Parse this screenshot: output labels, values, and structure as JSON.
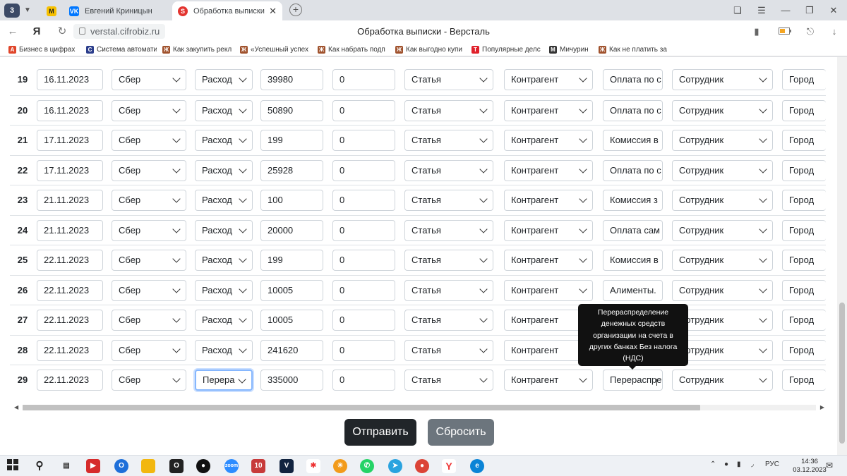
{
  "browser": {
    "tab_count": "3",
    "tabs": [
      {
        "label": "",
        "icon": "mail-icon",
        "active": false
      },
      {
        "label": "Евгений Криницын",
        "icon": "vk-icon",
        "active": false
      },
      {
        "label": "Обработка выписки - В",
        "icon": "cifrobiz-icon",
        "active": true
      }
    ],
    "url": "verstal.cifrobiz.ru",
    "page_title": "Обработка выписки - Версталь",
    "bookmarks": [
      "Бизнес в цифрах",
      "Система автомати",
      "Как закупить рекл",
      "«Успешный успех",
      "Как набрать подп",
      "Как выгодно купи",
      "Популярные делс",
      "Мичурин",
      "Как не платить за"
    ]
  },
  "table": {
    "rows": [
      {
        "num": "19",
        "date": "16.11.2023",
        "bank": "Сбер",
        "type": "Расход",
        "amount": "39980",
        "extra": "0",
        "article": "Статья",
        "counterparty": "Контрагент",
        "purpose": "Оплата по с",
        "employee": "Сотрудник",
        "city": "Город"
      },
      {
        "num": "20",
        "date": "16.11.2023",
        "bank": "Сбер",
        "type": "Расход",
        "amount": "50890",
        "extra": "0",
        "article": "Статья",
        "counterparty": "Контрагент",
        "purpose": "Оплата по с",
        "employee": "Сотрудник",
        "city": "Город"
      },
      {
        "num": "21",
        "date": "17.11.2023",
        "bank": "Сбер",
        "type": "Расход",
        "amount": "199",
        "extra": "0",
        "article": "Статья",
        "counterparty": "Контрагент",
        "purpose": "Комиссия в",
        "employee": "Сотрудник",
        "city": "Город"
      },
      {
        "num": "22",
        "date": "17.11.2023",
        "bank": "Сбер",
        "type": "Расход",
        "amount": "25928",
        "extra": "0",
        "article": "Статья",
        "counterparty": "Контрагент",
        "purpose": "Оплата по с",
        "employee": "Сотрудник",
        "city": "Город"
      },
      {
        "num": "23",
        "date": "21.11.2023",
        "bank": "Сбер",
        "type": "Расход",
        "amount": "100",
        "extra": "0",
        "article": "Статья",
        "counterparty": "Контрагент",
        "purpose": "Комиссия з",
        "employee": "Сотрудник",
        "city": "Город"
      },
      {
        "num": "24",
        "date": "21.11.2023",
        "bank": "Сбер",
        "type": "Расход",
        "amount": "20000",
        "extra": "0",
        "article": "Статья",
        "counterparty": "Контрагент",
        "purpose": "Оплата сам",
        "employee": "Сотрудник",
        "city": "Город"
      },
      {
        "num": "25",
        "date": "22.11.2023",
        "bank": "Сбер",
        "type": "Расход",
        "amount": "199",
        "extra": "0",
        "article": "Статья",
        "counterparty": "Контрагент",
        "purpose": "Комиссия в",
        "employee": "Сотрудник",
        "city": "Город"
      },
      {
        "num": "26",
        "date": "22.11.2023",
        "bank": "Сбер",
        "type": "Расход",
        "amount": "10005",
        "extra": "0",
        "article": "Статья",
        "counterparty": "Контрагент",
        "purpose": "Алименты.",
        "employee": "Сотрудник",
        "city": "Город"
      },
      {
        "num": "27",
        "date": "22.11.2023",
        "bank": "Сбер",
        "type": "Расход",
        "amount": "10005",
        "extra": "0",
        "article": "Статья",
        "counterparty": "Контрагент",
        "purpose": "",
        "employee": "Сотрудник",
        "city": "Город"
      },
      {
        "num": "28",
        "date": "22.11.2023",
        "bank": "Сбер",
        "type": "Расход",
        "amount": "241620",
        "extra": "0",
        "article": "Статья",
        "counterparty": "Контрагент",
        "purpose": "",
        "employee": "Сотрудник",
        "city": "Город"
      },
      {
        "num": "29",
        "date": "22.11.2023",
        "bank": "Сбер",
        "type": "Перера",
        "amount": "335000",
        "extra": "0",
        "article": "Статья",
        "counterparty": "Контрагент",
        "purpose": "Перераспре",
        "employee": "Сотрудник",
        "city": "Город"
      }
    ]
  },
  "tooltip": {
    "text": "Перераспределение денежных средств организации на счета в других банках Без налога (НДС)"
  },
  "actions": {
    "submit_label": "Отправить",
    "reset_label": "Сбросить"
  },
  "taskbar": {
    "language": "РУС",
    "time": "14:36",
    "date": "03.12.2023"
  },
  "colors": {
    "submit_bg": "#212529",
    "reset_bg": "#6c757d",
    "focus_border": "#86b7fe",
    "tooltip_bg": "#111111"
  }
}
